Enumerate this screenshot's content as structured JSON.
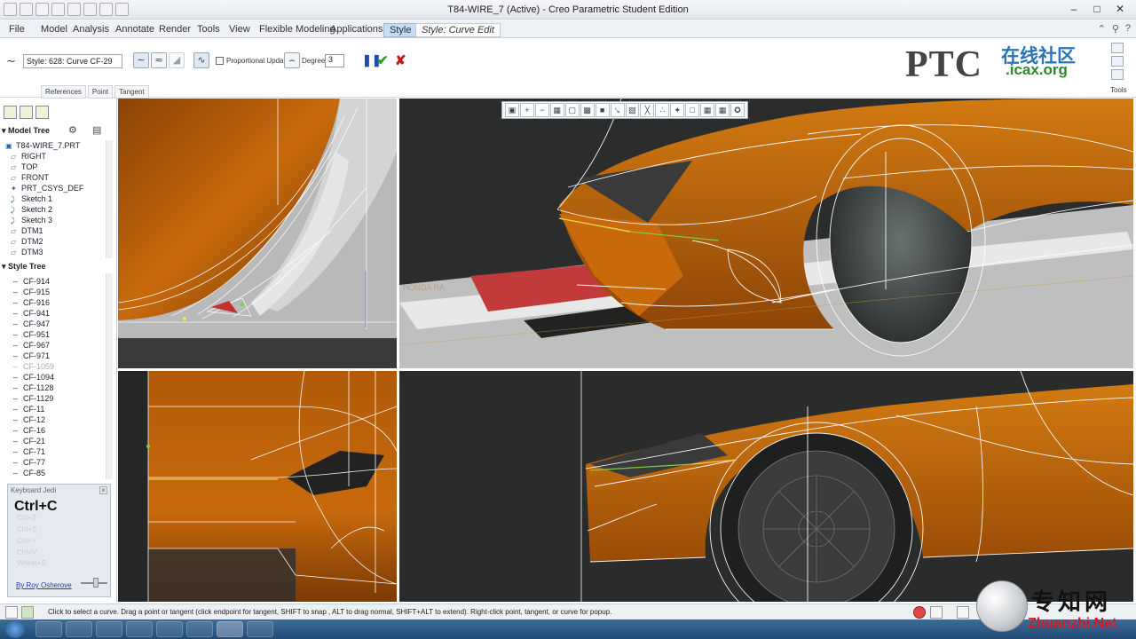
{
  "window": {
    "title": "T84-WIRE_7 (Active) - Creo Parametric Student Edition"
  },
  "menu": {
    "file": "File",
    "tabs": [
      "Model",
      "Analysis",
      "Annotate",
      "Render",
      "Tools",
      "View",
      "Flexible Modeling",
      "Applications",
      "Style",
      "Style: Curve Edit"
    ],
    "active_tab": "Style",
    "context_tab": "Style: Curve Edit"
  },
  "ribbon": {
    "style_field": "Style: 628: Curve   CF-29",
    "proportional_update": "Proportional Update",
    "degree_label": "Degree",
    "degree_value": "3",
    "subtabs": [
      "References",
      "Point",
      "Tangent"
    ],
    "tools_label": "Tools"
  },
  "logo": {
    "brand": "PTC",
    "cn": "在线社区",
    "url": ".icax.org"
  },
  "model_tree": {
    "header": "Model Tree",
    "items": [
      {
        "icon": "part-icon",
        "label": "T84-WIRE_7.PRT"
      },
      {
        "icon": "datum-plane-icon",
        "label": "RIGHT"
      },
      {
        "icon": "datum-plane-icon",
        "label": "TOP"
      },
      {
        "icon": "datum-plane-icon",
        "label": "FRONT"
      },
      {
        "icon": "csys-icon",
        "label": "PRT_CSYS_DEF"
      },
      {
        "icon": "sketch-icon",
        "label": "Sketch 1"
      },
      {
        "icon": "sketch-icon",
        "label": "Sketch 2"
      },
      {
        "icon": "sketch-icon",
        "label": "Sketch 3"
      },
      {
        "icon": "datum-plane-icon",
        "label": "DTM1"
      },
      {
        "icon": "datum-plane-icon",
        "label": "DTM2"
      },
      {
        "icon": "datum-plane-icon",
        "label": "DTM3"
      }
    ]
  },
  "style_tree": {
    "header": "Style Tree",
    "items": [
      "CF-914",
      "CF-915",
      "CF-916",
      "CF-941",
      "CF-947",
      "CF-951",
      "CF-967",
      "CF-971",
      "CF-1059",
      "CF-1094",
      "CF-1128",
      "CF-1129",
      "CF-11",
      "CF-12",
      "CF-16",
      "CF-21",
      "CF-71",
      "CF-77",
      "CF-85"
    ],
    "dimmed": [
      "CF-1059"
    ]
  },
  "keyboard_jedi": {
    "title": "Keyboard Jedi",
    "combo": "Ctrl+C",
    "ghost_lines": [
      "Ctrl+Z",
      "Ctrl+S",
      "Ctrl+Y",
      "Ctrl+V",
      "Wheel+S"
    ],
    "author": "By Roy Osherove"
  },
  "viewport": {
    "overlay_text": "HONDA RA"
  },
  "status": {
    "message": "Click to select a curve.  Drag a point or tangent (click endpoint for tangent, SHIFT to snap , ALT to drag normal, SHIFT+ALT to extend). Right-click point, tangent, or curve for popup."
  },
  "watermark": {
    "cn": "专知网",
    "en": "Zhuanzhi.Net"
  },
  "colors": {
    "surface_orange": "#c86a0c",
    "viewport_dark": "#2b2b2b",
    "accent_blue": "#2a73b8"
  }
}
